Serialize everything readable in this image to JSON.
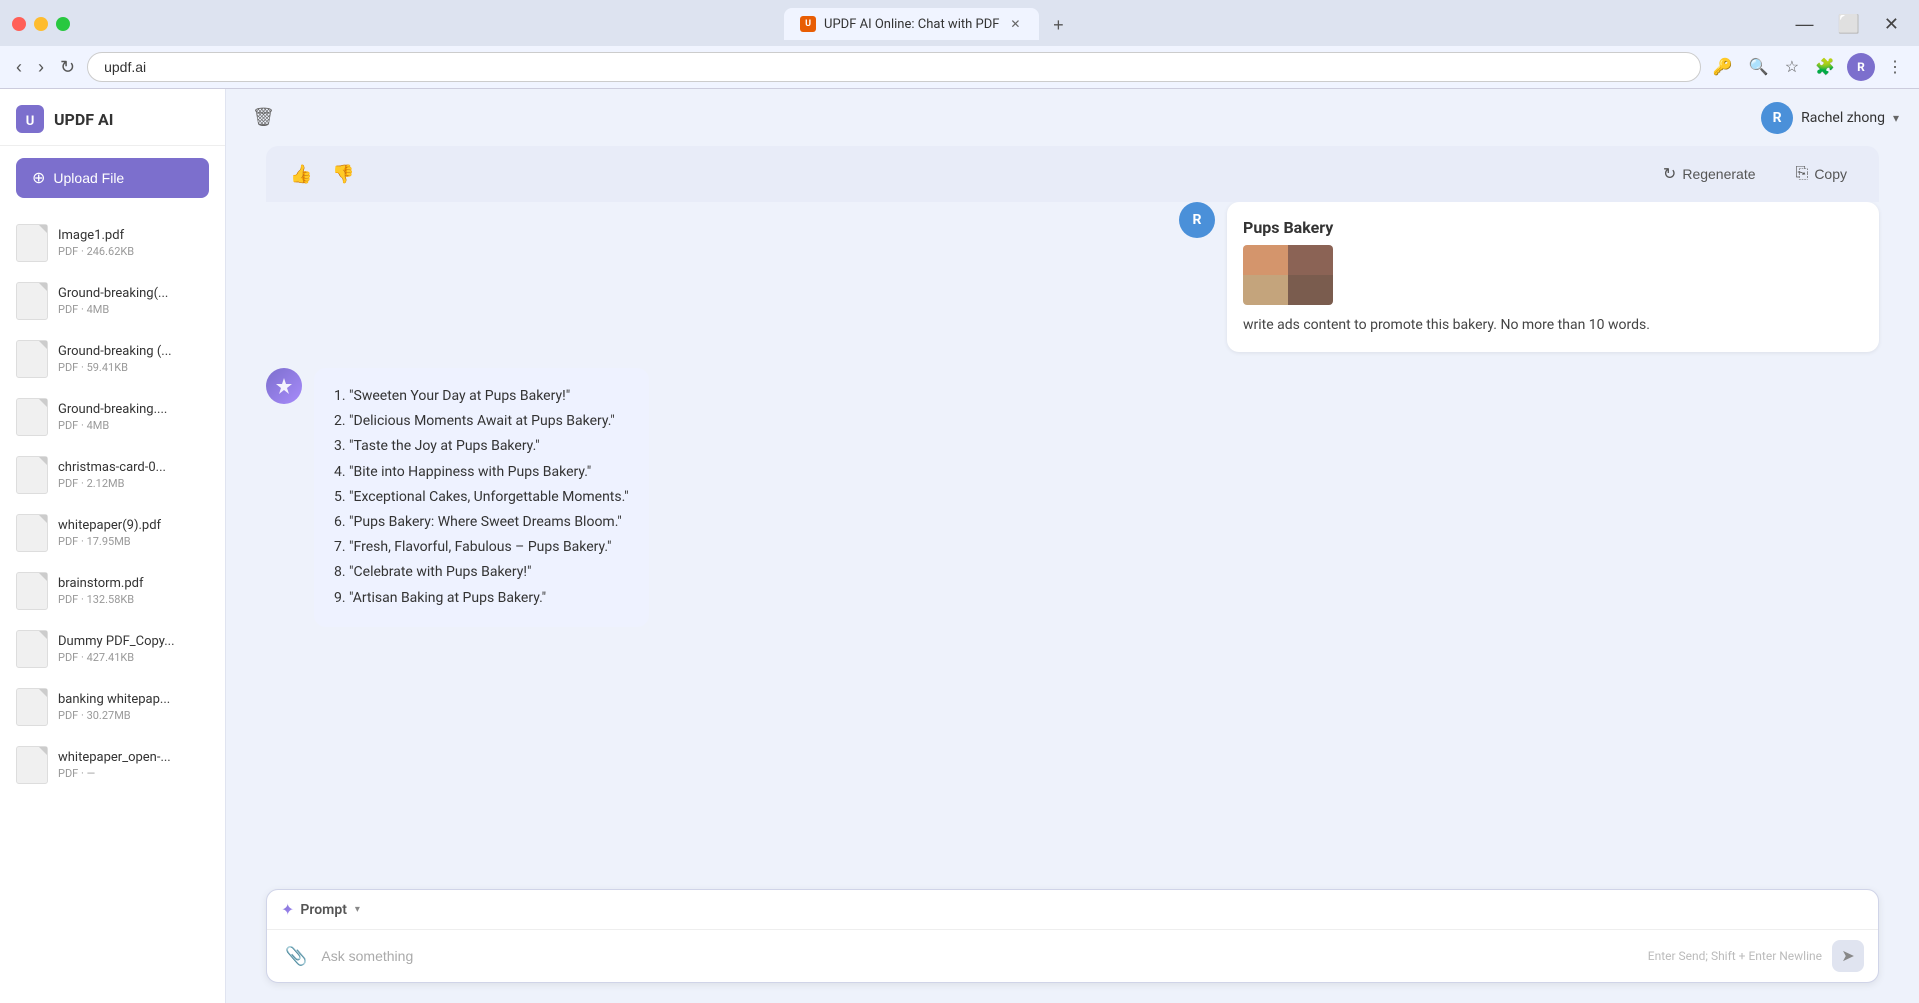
{
  "browser": {
    "tab_title": "UPDF AI Online: Chat with PDF",
    "url": "updf.ai",
    "new_tab_label": "+",
    "minimize": "—",
    "maximize": "⬜",
    "close": "✕"
  },
  "sidebar": {
    "brand_name": "UPDF AI",
    "upload_btn_label": "Upload File",
    "files": [
      {
        "name": "Image1.pdf",
        "size": "PDF · 246.62KB"
      },
      {
        "name": "Ground-breaking(...",
        "size": "PDF · 4MB"
      },
      {
        "name": "Ground-breaking (...",
        "size": "PDF · 59.41KB"
      },
      {
        "name": "Ground-breaking....",
        "size": "PDF · 4MB"
      },
      {
        "name": "christmas-card-0...",
        "size": "PDF · 2.12MB"
      },
      {
        "name": "whitepaper(9).pdf",
        "size": "PDF · 17.95MB"
      },
      {
        "name": "brainstorm.pdf",
        "size": "PDF · 132.58KB"
      },
      {
        "name": "Dummy PDF_Copy...",
        "size": "PDF · 427.41KB"
      },
      {
        "name": "banking whitepap...",
        "size": "PDF · 30.27MB"
      },
      {
        "name": "whitepaper_open-...",
        "size": "PDF · —"
      }
    ]
  },
  "header": {
    "trash_icon": "🗑",
    "user_name": "Rachel zhong",
    "user_initial": "R",
    "chevron": "▾"
  },
  "feedback_bar": {
    "like_icon": "👍",
    "dislike_icon": "👎",
    "regenerate_label": "Regenerate",
    "copy_label": "Copy"
  },
  "user_message": {
    "avatar_initial": "R",
    "bakery_title": "Pups Bakery",
    "message_text": "write ads content to promote this bakery. No more than 10 words."
  },
  "ai_response": {
    "items": [
      "\"Sweeten Your Day at Pups Bakery!\"",
      "\"Delicious Moments Await at Pups Bakery.\"",
      "\"Taste the Joy at Pups Bakery.\"",
      "\"Bite into Happiness with Pups Bakery.\"",
      "\"Exceptional Cakes, Unforgettable Moments.\"",
      "\"Pups Bakery: Where Sweet Dreams Bloom.\"",
      "\"Fresh, Flavorful, Fabulous – Pups Bakery.\"",
      "\"Celebrate with Pups Bakery!\"",
      "\"Artisan Baking at Pups Bakery.\""
    ]
  },
  "input_area": {
    "prompt_label": "Prompt",
    "placeholder": "Ask something",
    "hint_text": "Enter Send; Shift + Enter Newline",
    "attach_icon": "📎",
    "send_icon": "➤",
    "sparkle_icon": "✦",
    "arrow_icon": "▾"
  }
}
